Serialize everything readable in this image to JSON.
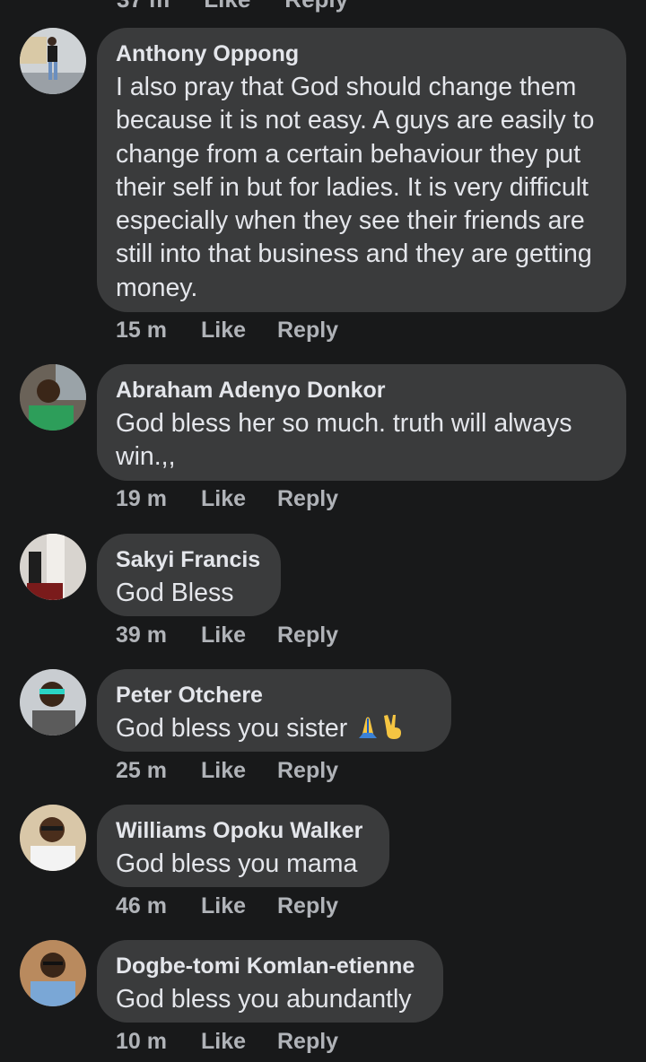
{
  "partial_top": {
    "time": "37 m",
    "like_label": "Like",
    "reply_label": "Reply"
  },
  "comments": [
    {
      "author": "Anthony Oppong",
      "text": "I also pray that God should change them because it is not easy. A guys are easily to change from a certain behaviour they put their self in but for ladies. It is very difficult especially when they see their friends are still into that business and they are getting money.",
      "time": "15 m",
      "like_label": "Like",
      "reply_label": "Reply"
    },
    {
      "author": "Abraham Adenyo Donkor",
      "text": "God bless her so much. truth will always win.,,",
      "time": "19 m",
      "like_label": "Like",
      "reply_label": "Reply"
    },
    {
      "author": "Sakyi Francis",
      "text": "God Bless",
      "time": "39 m",
      "like_label": "Like",
      "reply_label": "Reply"
    },
    {
      "author": "Peter Otchere",
      "text": "God bless you sister",
      "time": "25 m",
      "like_label": "Like",
      "reply_label": "Reply",
      "emojis": [
        "folded-hands-emoji",
        "victory-hand-emoji"
      ]
    },
    {
      "author": "Williams Opoku Walker",
      "text": "God bless you mama",
      "time": "46 m",
      "like_label": "Like",
      "reply_label": "Reply"
    },
    {
      "author": "Dogbe-tomi Komlan-etienne",
      "text": "God bless you abundantly",
      "time": "10 m",
      "like_label": "Like",
      "reply_label": "Reply"
    }
  ],
  "colors": {
    "background": "#18191a",
    "bubble": "#3a3b3c",
    "primary_text": "#e4e6eb",
    "secondary_text": "#b0b3b8"
  }
}
